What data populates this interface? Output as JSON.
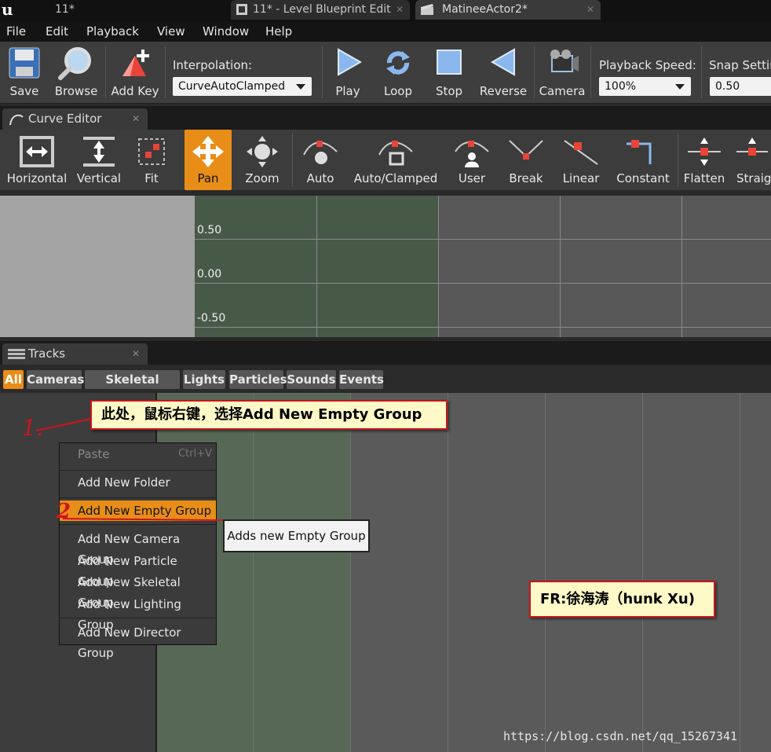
{
  "window_tabs": [
    {
      "label": "11*"
    },
    {
      "label": "11* - Level Blueprint Edit"
    },
    {
      "label": "MatineeActor2*"
    }
  ],
  "menubar": [
    "File",
    "Edit",
    "Playback",
    "View",
    "Window",
    "Help"
  ],
  "toolbar": {
    "buttons": [
      "Save",
      "Browse",
      "Add Key",
      "Play",
      "Loop",
      "Stop",
      "Reverse",
      "Camera"
    ],
    "interpolation_label": "Interpolation:",
    "interpolation_value": "CurveAutoClamped",
    "playback_speed_label": "Playback Speed:",
    "playback_speed_value": "100%",
    "snap_label": "Snap Settin",
    "snap_value": "0.50"
  },
  "curve_editor": {
    "tab_label": "Curve Editor",
    "buttons": [
      "Horizontal",
      "Vertical",
      "Fit",
      "Pan",
      "Zoom",
      "Auto",
      "Auto/Clamped",
      "User",
      "Break",
      "Linear",
      "Constant",
      "Flatten",
      "Straigh"
    ],
    "active_button": "Pan",
    "y_labels": [
      "0.50",
      "0.00",
      "-0.50"
    ]
  },
  "tracks": {
    "tab_label": "Tracks",
    "filters": [
      "All",
      "Cameras",
      "Skeletal Meshes",
      "Lights",
      "Particles",
      "Sounds",
      "Events"
    ],
    "active_filter": "All"
  },
  "context_menu": {
    "paste": "Paste",
    "paste_shortcut": "Ctrl+V",
    "add_folder": "Add New Folder",
    "add_empty_group": "Add New Empty Group",
    "add_camera_group": "Add New Camera Group",
    "add_particle_group": "Add New Particle Group",
    "add_skeletal_group": "Add New Skeletal Group",
    "add_lighting_group": "Add New Lighting Group",
    "add_director_group": "Add New Director Group"
  },
  "tooltip": "Adds new Empty Group",
  "annotations": {
    "note1": "此处，鼠标右键，选择Add New Empty Group",
    "note2": "FR:徐海涛（hunk Xu)",
    "mark1": "1.",
    "mark2": "2"
  },
  "watermark": "https://blog.csdn.net/qq_15267341",
  "colors": {
    "accent": "#e88e18",
    "note_border": "#c8141b",
    "note_bg": "#fff9c8"
  }
}
